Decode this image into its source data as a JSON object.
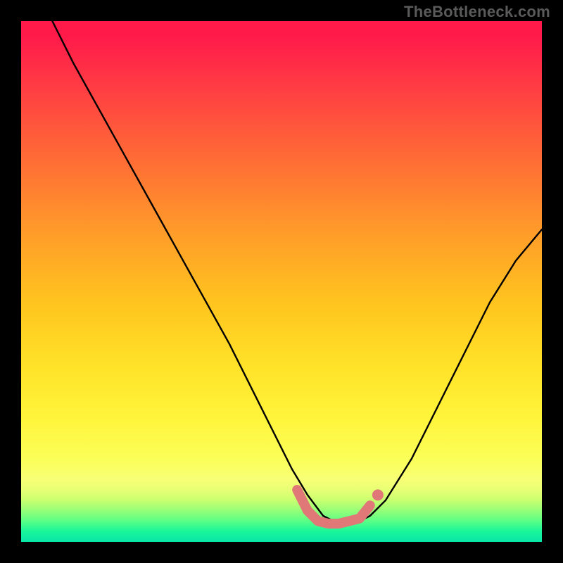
{
  "watermark": "TheBottleneck.com",
  "chart_data": {
    "type": "line",
    "title": "",
    "xlabel": "",
    "ylabel": "",
    "xlim": [
      0,
      100
    ],
    "ylim": [
      0,
      100
    ],
    "background_gradient": {
      "direction": "bottom",
      "stops": [
        {
          "pct": 0,
          "color": "#ff1a4a"
        },
        {
          "pct": 40,
          "color": "#ff9a2a"
        },
        {
          "pct": 70,
          "color": "#fff43a"
        },
        {
          "pct": 92,
          "color": "#c8ff70"
        },
        {
          "pct": 100,
          "color": "#0ae6a8"
        }
      ]
    },
    "series": [
      {
        "name": "curve",
        "stroke": "#000000",
        "x": [
          6,
          10,
          15,
          20,
          25,
          30,
          35,
          40,
          45,
          50,
          52,
          55,
          58,
          60,
          63,
          65,
          67,
          70,
          75,
          80,
          85,
          90,
          95,
          100
        ],
        "y": [
          100,
          92,
          83,
          74,
          65,
          56,
          47,
          38,
          28,
          18,
          14,
          9,
          5,
          4,
          4,
          4,
          5,
          8,
          16,
          26,
          36,
          46,
          54,
          60
        ]
      }
    ],
    "annotations": [
      {
        "name": "valley-marker",
        "type": "polyline",
        "stroke": "#e07878",
        "stroke_width": 14,
        "round_caps": true,
        "x": [
          53,
          55,
          57,
          59,
          61,
          63,
          65,
          67
        ],
        "y": [
          10,
          6,
          4,
          3.5,
          3.5,
          4,
          4.5,
          7
        ]
      },
      {
        "name": "valley-end-dot",
        "type": "dot",
        "fill": "#e07878",
        "r": 8,
        "x": 68.5,
        "y": 9
      }
    ]
  }
}
